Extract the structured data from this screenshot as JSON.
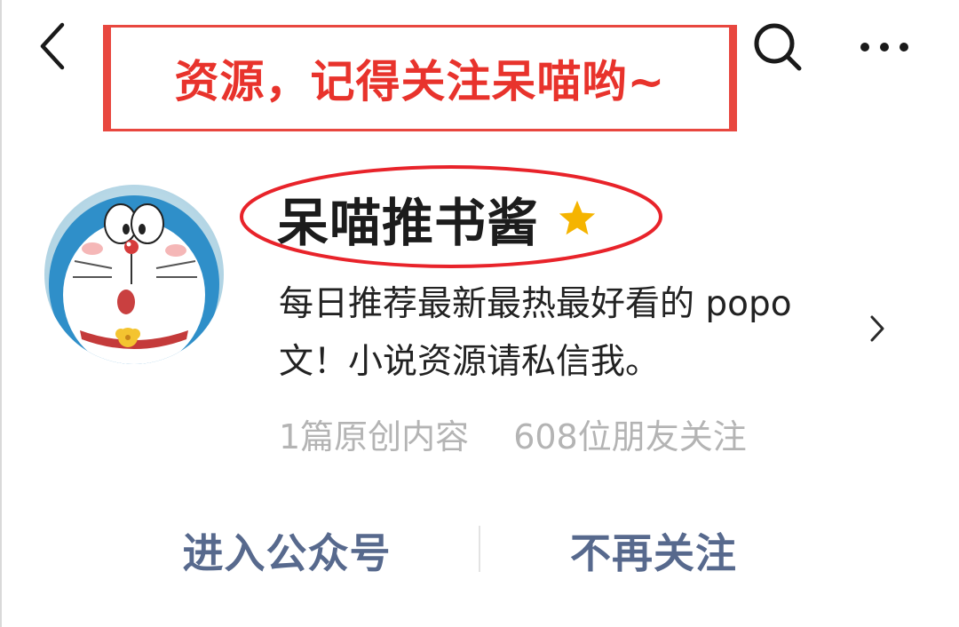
{
  "top_bar": {
    "banner_text": "资源，记得关注呆喵哟~"
  },
  "profile": {
    "name": "呆喵推书酱",
    "bio_line1": "每日推荐最新最热最好看的 popo",
    "bio_line2": "文！小说资源请私信我。",
    "original_count": "1篇原创内容",
    "followers": "608位朋友关注"
  },
  "actions": {
    "enter_label": "进入公众号",
    "unfollow_label": "不再关注"
  },
  "colors": {
    "accent_red": "#e8332c",
    "action_blue": "#57698d",
    "star_gold": "#f5b400",
    "muted_text": "#b4b4b4"
  },
  "icons": {
    "back": "chevron-left-icon",
    "search": "search-icon",
    "more": "more-dots-icon",
    "star": "star-icon",
    "chevron": "chevron-right-icon"
  }
}
